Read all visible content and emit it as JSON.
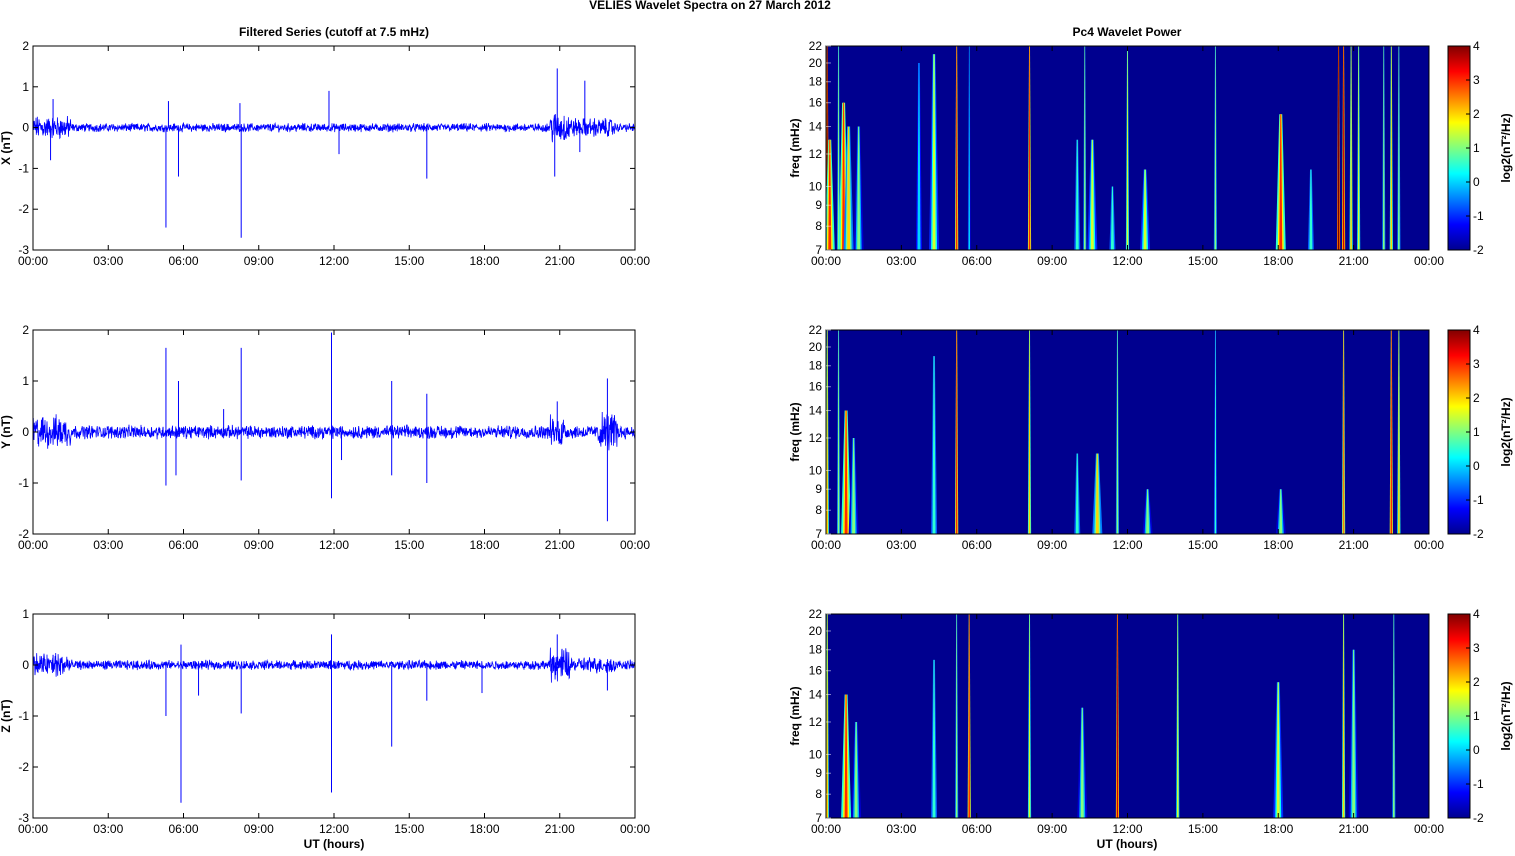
{
  "title": "VELIES Wavelet Spectra on 27 March     2012",
  "left_title": "Filtered Series (cutoff at 7.5 mHz)",
  "right_title": "Pc4 Wavelet Power",
  "xlabel": "UT (hours)",
  "xticks": [
    "00:00",
    "03:00",
    "06:00",
    "09:00",
    "12:00",
    "15:00",
    "18:00",
    "21:00",
    "00:00"
  ],
  "colors": {
    "trace": "#0000ff",
    "background": "#00008f"
  },
  "chart_data": [
    {
      "type": "line",
      "component": "X",
      "ylabel": "X (nT)",
      "ylim": [
        -3,
        2
      ],
      "yticks": [
        2,
        1,
        0,
        -1,
        -2,
        -3
      ],
      "xlim": [
        0,
        24
      ],
      "noise_amplitude": 0.08,
      "bursts": [
        [
          0,
          1.5,
          0.22
        ],
        [
          20.6,
          21.4,
          0.3
        ],
        [
          21.4,
          23.2,
          0.18
        ]
      ],
      "spikes": [
        [
          0.8,
          0.7
        ],
        [
          0.7,
          -0.8
        ],
        [
          5.3,
          -2.45
        ],
        [
          5.4,
          0.65
        ],
        [
          5.8,
          -1.2
        ],
        [
          8.3,
          -2.7
        ],
        [
          8.25,
          0.6
        ],
        [
          11.8,
          0.9
        ],
        [
          12.2,
          -0.65
        ],
        [
          15.7,
          -1.25
        ],
        [
          20.9,
          1.45
        ],
        [
          20.8,
          -1.2
        ],
        [
          22.0,
          1.15
        ],
        [
          21.8,
          -0.6
        ]
      ]
    },
    {
      "type": "line",
      "component": "Y",
      "ylabel": "Y (nT)",
      "ylim": [
        -2,
        2
      ],
      "yticks": [
        2,
        1,
        0,
        -1,
        -2
      ],
      "xlim": [
        0,
        24
      ],
      "noise_amplitude": 0.1,
      "bursts": [
        [
          0,
          1.5,
          0.25
        ],
        [
          20.6,
          21.2,
          0.25
        ],
        [
          22.5,
          23.3,
          0.3
        ]
      ],
      "spikes": [
        [
          5.3,
          1.65
        ],
        [
          5.3,
          -1.05
        ],
        [
          5.8,
          1.0
        ],
        [
          5.7,
          -0.85
        ],
        [
          7.6,
          0.45
        ],
        [
          8.3,
          1.65
        ],
        [
          8.3,
          -0.95
        ],
        [
          11.9,
          1.95
        ],
        [
          11.9,
          -1.3
        ],
        [
          12.3,
          -0.55
        ],
        [
          14.3,
          1.0
        ],
        [
          14.3,
          -0.85
        ],
        [
          15.7,
          0.75
        ],
        [
          15.7,
          -1.0
        ],
        [
          20.9,
          0.6
        ],
        [
          22.9,
          1.05
        ],
        [
          22.9,
          -1.75
        ]
      ]
    },
    {
      "type": "line",
      "component": "Z",
      "ylabel": "Z (nT)",
      "ylim": [
        -3,
        1
      ],
      "yticks": [
        1,
        0,
        -1,
        -2,
        -3
      ],
      "xlim": [
        0,
        24
      ],
      "noise_amplitude": 0.07,
      "bursts": [
        [
          0,
          1.5,
          0.2
        ],
        [
          20.6,
          21.4,
          0.25
        ],
        [
          21.4,
          23.2,
          0.12
        ]
      ],
      "spikes": [
        [
          0.8,
          0.2
        ],
        [
          5.3,
          -1.0
        ],
        [
          5.9,
          -2.7
        ],
        [
          5.9,
          0.4
        ],
        [
          6.6,
          -0.6
        ],
        [
          8.3,
          -0.95
        ],
        [
          11.9,
          0.6
        ],
        [
          11.9,
          -2.5
        ],
        [
          14.3,
          -1.6
        ],
        [
          15.7,
          -0.7
        ],
        [
          17.9,
          -0.55
        ],
        [
          20.9,
          0.6
        ],
        [
          22.9,
          -0.5
        ]
      ]
    },
    {
      "type": "heatmap",
      "component": "X",
      "ylabel": "freq (mHz)",
      "ylim": [
        7,
        22
      ],
      "yticks": [
        22,
        20,
        18,
        16,
        14,
        12,
        10,
        9,
        8,
        7
      ],
      "xlim": [
        0,
        24
      ],
      "clabel": "log2(nT²/Hz)",
      "clim": [
        -2,
        4
      ],
      "cticks": [
        4,
        3,
        2,
        1,
        0,
        -1,
        -2
      ],
      "events": [
        [
          0.05,
          4,
          22
        ],
        [
          0.15,
          3,
          13
        ],
        [
          0.5,
          1,
          22
        ],
        [
          0.7,
          3,
          16
        ],
        [
          0.9,
          2,
          14
        ],
        [
          1.3,
          1,
          14
        ],
        [
          3.7,
          0,
          20
        ],
        [
          4.3,
          1.5,
          21
        ],
        [
          5.2,
          3,
          22
        ],
        [
          5.7,
          0,
          22
        ],
        [
          8.1,
          3,
          22
        ],
        [
          10.0,
          0.5,
          13
        ],
        [
          10.3,
          1,
          22
        ],
        [
          10.6,
          1.5,
          13
        ],
        [
          11.4,
          0.5,
          10
        ],
        [
          12.0,
          1.5,
          22
        ],
        [
          12.7,
          1.5,
          11
        ],
        [
          15.5,
          1,
          22
        ],
        [
          18.1,
          3,
          15
        ],
        [
          19.3,
          0.5,
          11
        ],
        [
          20.4,
          4,
          22
        ],
        [
          20.6,
          3.5,
          22
        ],
        [
          20.9,
          2,
          22
        ],
        [
          21.2,
          1.5,
          22
        ],
        [
          22.2,
          1,
          22
        ],
        [
          22.5,
          2,
          22
        ],
        [
          22.8,
          1,
          22
        ]
      ]
    },
    {
      "type": "heatmap",
      "component": "Y",
      "ylabel": "freq (mHz)",
      "ylim": [
        7,
        22
      ],
      "yticks": [
        22,
        20,
        18,
        16,
        14,
        12,
        10,
        9,
        8,
        7
      ],
      "xlim": [
        0,
        24
      ],
      "clabel": "log2(nT²/Hz)",
      "clim": [
        -2,
        4
      ],
      "cticks": [
        4,
        3,
        2,
        1,
        0,
        -1,
        -2
      ],
      "events": [
        [
          0.05,
          2,
          22
        ],
        [
          0.5,
          1,
          22
        ],
        [
          0.8,
          3,
          14
        ],
        [
          1.1,
          1,
          12
        ],
        [
          4.3,
          0.5,
          19
        ],
        [
          5.2,
          3,
          22
        ],
        [
          8.1,
          2,
          22
        ],
        [
          10.0,
          0.5,
          11
        ],
        [
          10.8,
          2,
          11
        ],
        [
          11.6,
          1,
          22
        ],
        [
          12.8,
          1,
          9
        ],
        [
          15.5,
          0.5,
          22
        ],
        [
          18.1,
          1,
          9
        ],
        [
          20.6,
          2.5,
          22
        ],
        [
          22.5,
          3,
          22
        ],
        [
          22.8,
          2,
          22
        ]
      ]
    },
    {
      "type": "heatmap",
      "component": "Z",
      "ylabel": "freq (mHz)",
      "ylim": [
        7,
        22
      ],
      "yticks": [
        22,
        20,
        18,
        16,
        14,
        12,
        10,
        9,
        8,
        7
      ],
      "xlim": [
        0,
        24
      ],
      "clabel": "log2(nT²/Hz)",
      "clim": [
        -2,
        4
      ],
      "cticks": [
        4,
        3,
        2,
        1,
        0,
        -1,
        -2
      ],
      "events": [
        [
          0.05,
          2,
          22
        ],
        [
          0.8,
          3,
          14
        ],
        [
          1.2,
          1,
          12
        ],
        [
          4.3,
          0.5,
          17
        ],
        [
          5.2,
          1,
          22
        ],
        [
          5.7,
          3,
          22
        ],
        [
          8.1,
          1.5,
          22
        ],
        [
          10.2,
          1,
          13
        ],
        [
          11.6,
          3.5,
          22
        ],
        [
          14.0,
          1.5,
          22
        ],
        [
          18.0,
          1.5,
          15
        ],
        [
          20.6,
          2,
          22
        ],
        [
          21.0,
          1,
          18
        ],
        [
          22.6,
          1,
          22
        ]
      ]
    }
  ]
}
